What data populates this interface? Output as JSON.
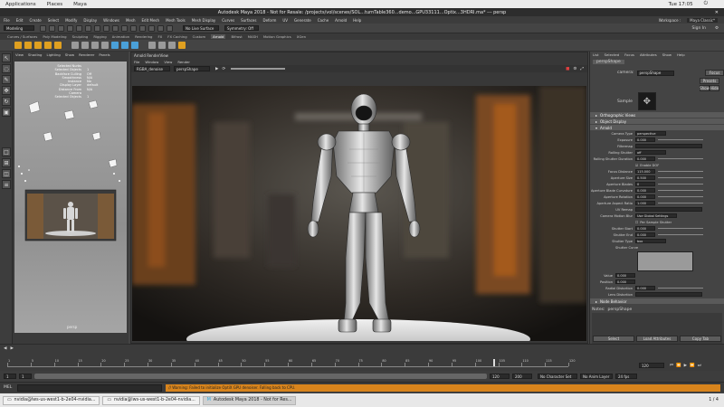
{
  "gnome": {
    "applications": "Applications",
    "places": "Places",
    "app": "Maya",
    "clock": "Tue 17:05"
  },
  "window": {
    "title": "Autodesk Maya 2018 - Not for Resale: /projects/vol/scenes/SOL...turnTable360...demo...GPU33111...Optix...3HDRI.ma*  ---  persp"
  },
  "menus": [
    "File",
    "Edit",
    "Create",
    "Select",
    "Modify",
    "Display",
    "Windows",
    "Mesh",
    "Edit Mesh",
    "Mesh Tools",
    "Mesh Display",
    "Curves",
    "Surfaces",
    "Deform",
    "UV",
    "Generate",
    "Cache",
    "Arnold",
    "Help"
  ],
  "workspace": {
    "label": "Workspace :",
    "value": "Maya Classic*"
  },
  "status_line": {
    "mode": "Modeling",
    "live_surface": "No Live Surface",
    "symmetry": "Symmetry: Off",
    "sign_in": "Sign In"
  },
  "shelf_tabs": [
    "Curves / Surfaces",
    "Poly Modeling",
    "Sculpting",
    "Rigging",
    "Animation",
    "Rendering",
    "FX",
    "FX Caching",
    "Custom",
    "Arnold",
    "Bifrost",
    "MASH",
    "Motion Graphics",
    "XGen"
  ],
  "shelf_active": "Arnold",
  "left_view": {
    "menu": [
      "View",
      "Shading",
      "Lighting",
      "Show",
      "Renderer",
      "Panels"
    ],
    "label": "persp",
    "hud": [
      {
        "k": "Selected Nurbs",
        "v": ""
      },
      {
        "k": "Selected Objects",
        "v": "1"
      },
      {
        "k": "Backface Culling",
        "v": "Off"
      },
      {
        "k": "Smoothness",
        "v": "N/A"
      },
      {
        "k": "Instance",
        "v": "No"
      },
      {
        "k": "Display Layer",
        "v": "default"
      },
      {
        "k": "Distance From Camera",
        "v": "N/A"
      },
      {
        "k": "Selected Objects",
        "v": "1"
      }
    ]
  },
  "render_view": {
    "title": "Arnold RenderView",
    "menu": [
      "File",
      "Window",
      "View",
      "Render"
    ],
    "aov": "RGBA_denoise",
    "camera": "perspShape",
    "status": "Rendering | 1920x1080 (OPTIX 80%) | perspShape | samples (AA:3, 3, 3)"
  },
  "attribute_editor": {
    "tabs": [
      "List",
      "Selected",
      "Focus",
      "Attributes",
      "Show",
      "Help"
    ],
    "node_tab": "perspShape",
    "camera_label": "camera:",
    "camera_value": "perspShape",
    "buttons": {
      "focus": "Focus",
      "presets": "Presets",
      "show": "Show",
      "hide": "Hide"
    },
    "sample": "Sample",
    "sections": [
      "Orthographic Views",
      "Object Display",
      "Arnold"
    ],
    "fields": [
      {
        "label": "Camera Type",
        "value": "perspective"
      },
      {
        "label": "Exposure",
        "value": "0.000"
      },
      {
        "label": "Filtermap",
        "value": ""
      },
      {
        "label": "Rolling Shutter",
        "value": "off"
      },
      {
        "label": "Rolling Shutter Duration",
        "value": "0.000"
      },
      {
        "label": "Enable DOF",
        "value": "Enable DOF"
      },
      {
        "label": "Focus Distance",
        "value": "115.000"
      },
      {
        "label": "Aperture Size",
        "value": "0.500"
      },
      {
        "label": "Aperture Blades",
        "value": "0"
      },
      {
        "label": "Aperture Blade Curvature",
        "value": "0.000"
      },
      {
        "label": "Aperture Rotation",
        "value": "0.000"
      },
      {
        "label": "Aperture Aspect Ratio",
        "value": "1.000"
      },
      {
        "label": "UV Remap",
        "value": ""
      },
      {
        "label": "Camera Motion Blur",
        "value": "Use Global Settings"
      },
      {
        "label": "Per Sample Shutter",
        "value": ""
      },
      {
        "label": "Shutter Start",
        "value": "0.000"
      },
      {
        "label": "Shutter End",
        "value": "0.000"
      },
      {
        "label": "Shutter Type",
        "value": "box"
      }
    ],
    "shutter_curve": "Shutter Curve",
    "value_label": "Value",
    "value_val": "0.000",
    "position_label": "Position",
    "position_val": "0.000",
    "radial_label": "Radial Distortion",
    "radial_val": "0.000",
    "lens_label": "Lens Distortion",
    "notes_label": "Notes:",
    "notes_value": "perspShape",
    "bottom_buttons": [
      "Select",
      "Load Attributes",
      "Copy Tab"
    ],
    "extra_tabs": [
      "Node Behavior"
    ]
  },
  "timeline": {
    "ticks": [
      "1",
      "5",
      "10",
      "15",
      "20",
      "25",
      "30",
      "35",
      "40",
      "45",
      "50",
      "55",
      "60",
      "65",
      "70",
      "75",
      "80",
      "85",
      "90",
      "95",
      "100",
      "105",
      "110",
      "115",
      "120"
    ],
    "current_frame": "120"
  },
  "range": {
    "start": "1",
    "min": "1",
    "end": "120",
    "max": "200",
    "character": "No Character Set",
    "anim_layer": "No Anim Layer",
    "fps": "24 fps"
  },
  "mel": {
    "label": "MEL",
    "message": "// Warning: Failed to initialize OptiX GPU denoiser. Falling back to CPU."
  },
  "taskbar": [
    {
      "label": "nvidia@lws-us-west1-b-2e04-nvidia...",
      "active": false
    },
    {
      "label": "nvidia@lws-us-west1-b-2e04-nvidia...",
      "active": false
    },
    {
      "label": "Autodesk Maya 2018 - Not for Res...",
      "active": true
    }
  ],
  "taskbar_pager": "1 / 4",
  "colors": {
    "accent": "#5285a6",
    "panel": "#444444",
    "dark": "#2a2a2a",
    "orange": "#d8841c"
  }
}
